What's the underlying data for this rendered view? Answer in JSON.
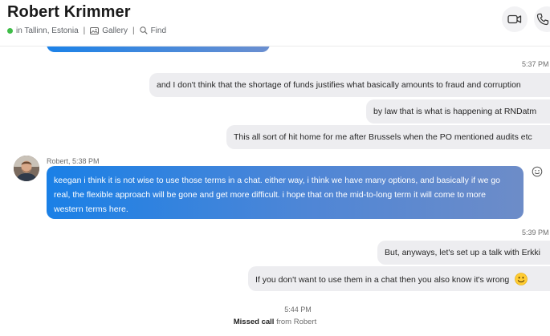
{
  "header": {
    "contact_name": "Robert Krimmer",
    "location": "in Tallinn, Estonia",
    "gallery": "Gallery",
    "find": "Find",
    "separator": "|"
  },
  "messages": {
    "time_1": "5:37 PM",
    "out_1": "and I don't think that the shortage of funds justifies what basically amounts to fraud and corruption",
    "out_2": "by law that is what is happening at RNDatm",
    "out_3": "This all sort of hit home for me after Brussels when the PO mentioned audits etc",
    "incoming_sender": "Robert, 5:38 PM",
    "in_1_line1": "keegan i think it is not wise to use those terms in a chat. either way, i think we have many options, and basically if we go",
    "in_1_line2": "real, the flexible approach will be gone and get more difficult. i hope that on the mid-to-long term it will come to more",
    "in_1_line3": "western terms here.",
    "time_2": "5:39 PM",
    "out_4": "But, anyways, let's set up a talk with Erkki",
    "out_5": "If you don't want to use them in a chat then you also know it's wrong",
    "call_time": "5:44 PM",
    "missed_label": "Missed call",
    "missed_from": "from Robert"
  },
  "colors": {
    "accent_gradient_start": "#1a80e6",
    "accent_gradient_end": "#6d8cc8",
    "outgoing_bubble": "#ededf0",
    "presence": "#3fbd48"
  },
  "icons": [
    "video-call-icon",
    "audio-call-icon",
    "gallery-icon",
    "find-icon",
    "add-reaction-icon",
    "smiley-emoji-icon"
  ]
}
